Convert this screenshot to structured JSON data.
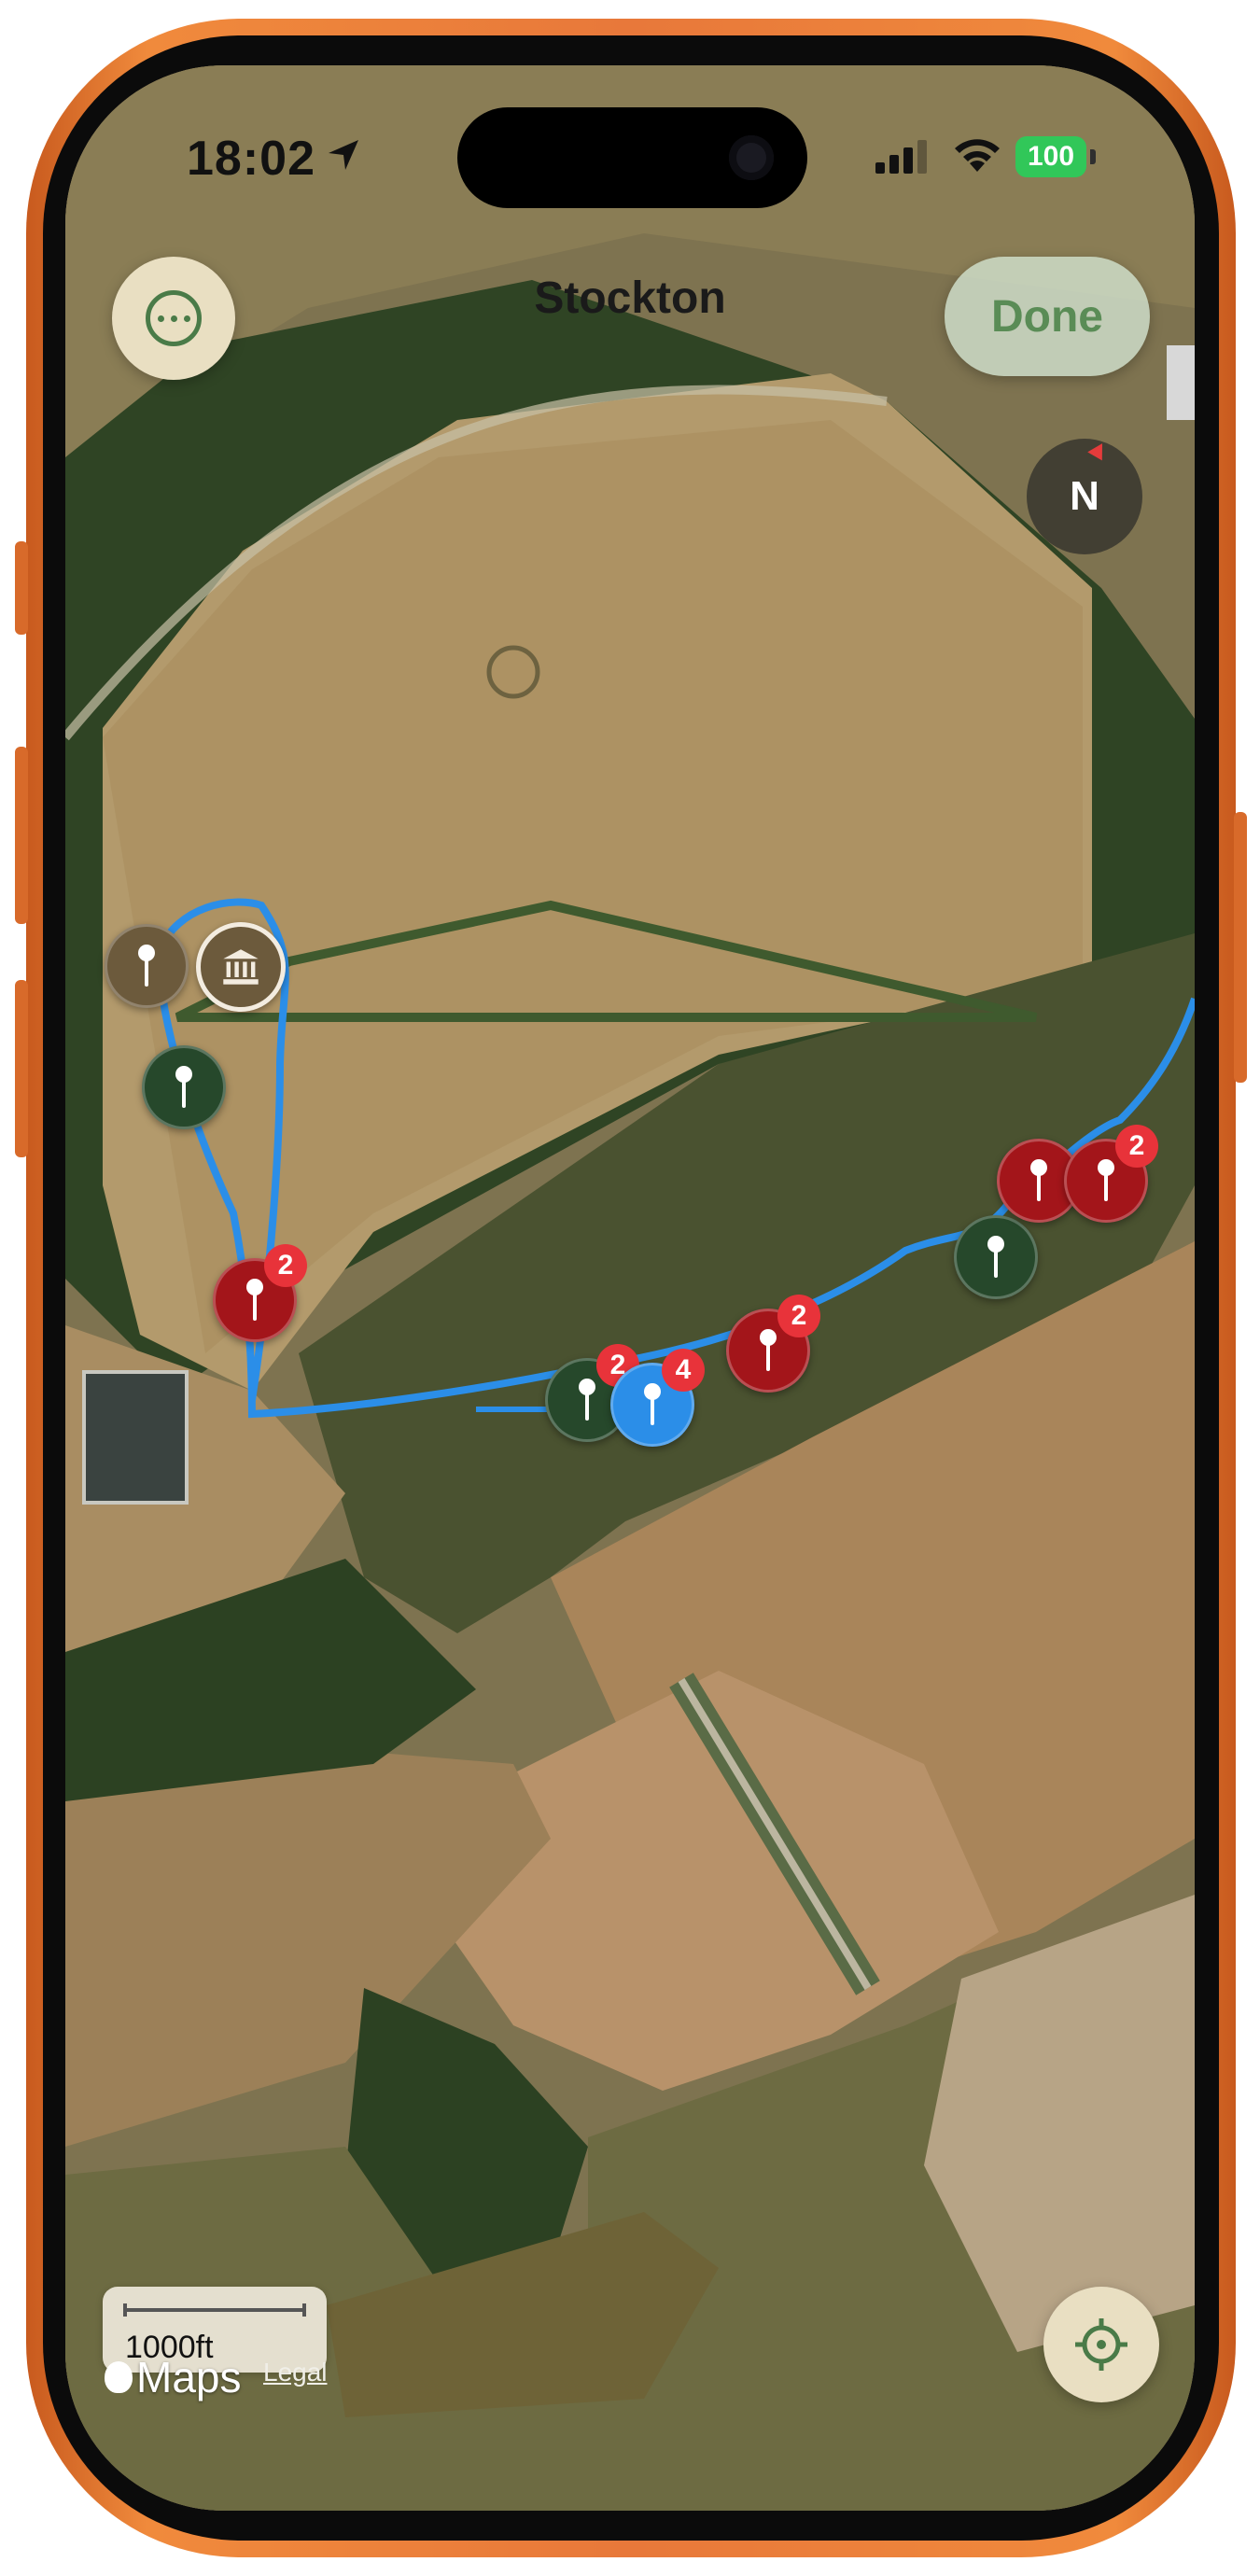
{
  "status_bar": {
    "time": "18:02",
    "battery": "100"
  },
  "nav": {
    "title": "Stockton",
    "done_label": "Done"
  },
  "compass": {
    "label": "N"
  },
  "pins": [
    {
      "type": "brown",
      "badge": ""
    },
    {
      "type": "museum",
      "badge": ""
    },
    {
      "type": "green",
      "badge": ""
    },
    {
      "type": "red",
      "badge": "2"
    },
    {
      "type": "green",
      "badge": "2"
    },
    {
      "type": "blue",
      "badge": "4"
    },
    {
      "type": "red",
      "badge": "2"
    },
    {
      "type": "green",
      "badge": ""
    },
    {
      "type": "red",
      "badge": ""
    },
    {
      "type": "red",
      "badge": "2"
    }
  ],
  "scale": {
    "label": "1000ft"
  },
  "attribution": {
    "maps": "Maps",
    "legal": "Legal"
  },
  "colors": {
    "track": "#2b8ee8",
    "red_pin": "#a3151a",
    "green_pin": "#26482b",
    "brown_pin": "#6c5a3c",
    "badge": "#e8333a",
    "frame": "#e8783a"
  }
}
